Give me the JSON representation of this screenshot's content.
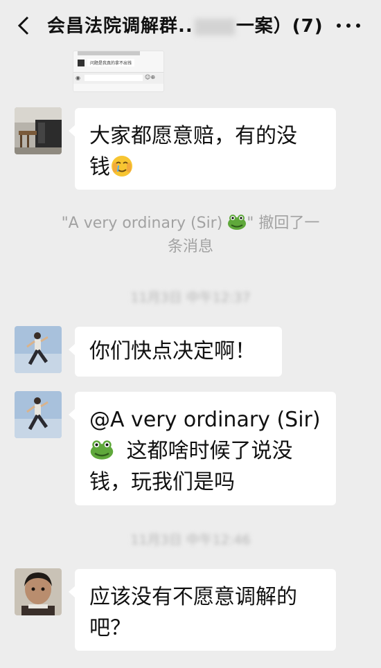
{
  "header": {
    "title_part1": "会昌法院调解群..",
    "title_part2": "一案）(7)",
    "back_icon": "chevron-left-icon",
    "more_icon": "more-dots-icon"
  },
  "thumbnail": {
    "bubble_text": "问题是我真的拿不出钱"
  },
  "messages": [
    {
      "text_before": "大家都愿意赔，有的没",
      "text_line2": "钱",
      "emoji": "face-holding-back-tears"
    },
    {
      "text": "你们快点决定啊！"
    },
    {
      "mention": "@A very ordinary (Sir)",
      "text_line2": "这都啥时候了说没",
      "text_line3": "钱，玩我们是吗"
    },
    {
      "text_line1": "应该没有不愿意调解的",
      "text_line2": "吧？"
    }
  ],
  "system_notice": {
    "line1": "\"A very ordinary (Sir) ",
    "line1_end": "\" 撤回了一",
    "line2": "条消息"
  },
  "timestamps": [
    "11月3日 中午12:37",
    "11月3日 中午12:46"
  ]
}
